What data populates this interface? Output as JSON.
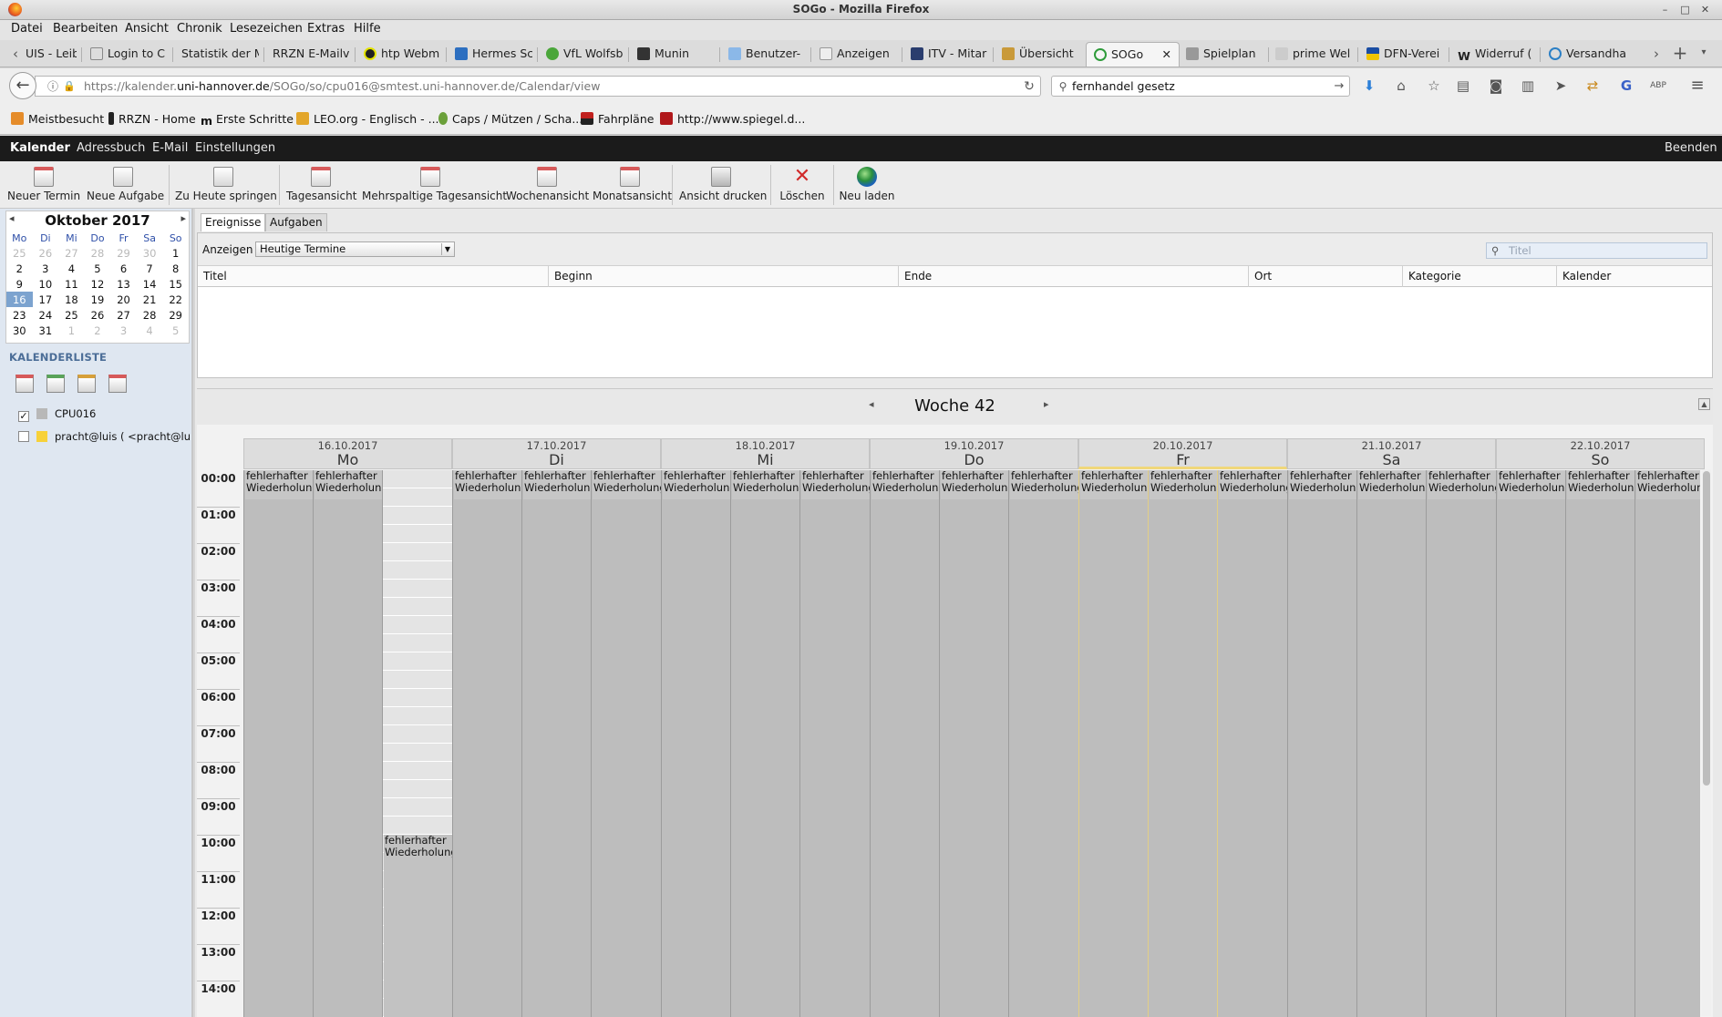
{
  "window": {
    "title": "SOGo - Mozilla Firefox"
  },
  "menu": [
    "Datei",
    "Bearbeiten",
    "Ansicht",
    "Chronik",
    "Lesezeichen",
    "Extras",
    "Hilfe"
  ],
  "tabs": [
    {
      "label": "UIS - Leib",
      "icon": "page-icon"
    },
    {
      "label": "Login to C",
      "icon": "ks-icon"
    },
    {
      "label": "Statistik der M",
      "icon": "page-icon"
    },
    {
      "label": "RRZN E-Mailve",
      "icon": "page-icon"
    },
    {
      "label": "htp Webm",
      "icon": "htp-icon"
    },
    {
      "label": "Hermes Sc",
      "icon": "hermes-icon"
    },
    {
      "label": "VfL Wolfsb",
      "icon": "vfl-icon"
    },
    {
      "label": "Munin",
      "icon": "munin-icon"
    },
    {
      "label": "Benutzer-",
      "icon": "benutzer-icon"
    },
    {
      "label": "Anzeigen",
      "icon": "tn-icon"
    },
    {
      "label": "ITV - Mitar",
      "icon": "itv-icon"
    },
    {
      "label": "Übersicht",
      "icon": "folder-icon"
    },
    {
      "label": "SOGo",
      "icon": "sogo-icon"
    },
    {
      "label": "Spielplan",
      "icon": "page-icon"
    },
    {
      "label": "prime Wel",
      "icon": "prime-icon"
    },
    {
      "label": "DFN-Verei",
      "icon": "dfn-icon"
    },
    {
      "label": "Widerruf (",
      "icon": "wikipedia-icon"
    },
    {
      "label": "Versandha",
      "icon": "reload-icon"
    }
  ],
  "nav": {
    "url_prefix": "https://kalender.",
    "url_domain": "uni-hannover.de",
    "url_rest": "/SOGo/so/cpu016@smtest.uni-hannover.de/Calendar/view",
    "search_value": "fernhandel gesetz"
  },
  "bookmarks": [
    {
      "label": "Meistbesucht",
      "icon": "rss-icon"
    },
    {
      "label": "RRZN - Home",
      "icon": "rrzn-icon"
    },
    {
      "label": "Erste Schritte",
      "icon": "m-icon"
    },
    {
      "label": "LEO.org - Englisch - ...",
      "icon": "leo-icon"
    },
    {
      "label": "Caps / Mützen / Scha...",
      "icon": "caps-icon"
    },
    {
      "label": "Fahrpläne",
      "icon": "vbn-icon"
    },
    {
      "label": "http://www.spiegel.d...",
      "icon": "spiegel-icon"
    }
  ],
  "sogo_nav": {
    "kalender": "Kalender",
    "adressbuch": "Adressbuch",
    "email": "E-Mail",
    "einstellungen": "Einstellungen",
    "beenden": "Beenden"
  },
  "toolbar": [
    "Neuer Termin",
    "Neue Aufgabe",
    "Zu Heute springen",
    "Tagesansicht",
    "Mehrspaltige Tagesansicht",
    "Wochenansicht",
    "Monatsansicht",
    "Ansicht drucken",
    "Löschen",
    "Neu laden"
  ],
  "minical": {
    "month": "Oktober",
    "year": "2017",
    "weekdays": [
      "Mo",
      "Di",
      "Mi",
      "Do",
      "Fr",
      "Sa",
      "So"
    ],
    "weeks": [
      [
        "25",
        "26",
        "27",
        "28",
        "29",
        "30",
        "1"
      ],
      [
        "2",
        "3",
        "4",
        "5",
        "6",
        "7",
        "8"
      ],
      [
        "9",
        "10",
        "11",
        "12",
        "13",
        "14",
        "15"
      ],
      [
        "16",
        "17",
        "18",
        "19",
        "20",
        "21",
        "22"
      ],
      [
        "23",
        "24",
        "25",
        "26",
        "27",
        "28",
        "29"
      ],
      [
        "30",
        "31",
        "1",
        "2",
        "3",
        "4",
        "5"
      ]
    ]
  },
  "calendar_list": {
    "label": "KALENDERLISTE",
    "items": [
      {
        "name": "CPU016",
        "checked": true,
        "color": "#b8b8b8"
      },
      {
        "name": "pracht@luis ( <pracht@luis",
        "checked": false,
        "color": "#f7d13a"
      }
    ]
  },
  "events_panel": {
    "tab_events": "Ereignisse",
    "tab_tasks": "Aufgaben",
    "filter_label": "Anzeigen",
    "filter_value": "Heutige Termine",
    "search_placeholder": "Titel",
    "columns": [
      "Titel",
      "Beginn",
      "Ende",
      "Ort",
      "Kategorie",
      "Kalender"
    ]
  },
  "week": {
    "label": "Woche 42",
    "days": [
      {
        "date": "16.10.2017",
        "name": "Mo"
      },
      {
        "date": "17.10.2017",
        "name": "Di"
      },
      {
        "date": "18.10.2017",
        "name": "Mi"
      },
      {
        "date": "19.10.2017",
        "name": "Do"
      },
      {
        "date": "20.10.2017",
        "name": "Fr"
      },
      {
        "date": "21.10.2017",
        "name": "Sa"
      },
      {
        "date": "22.10.2017",
        "name": "So"
      }
    ],
    "hours": [
      "00:00",
      "01:00",
      "02:00",
      "03:00",
      "04:00",
      "05:00",
      "06:00",
      "07:00",
      "08:00",
      "09:00",
      "10:00",
      "11:00",
      "12:00",
      "13:00",
      "14:00"
    ],
    "event_title": "fehlerhafter",
    "event_subtitle": "Wiederholung"
  }
}
